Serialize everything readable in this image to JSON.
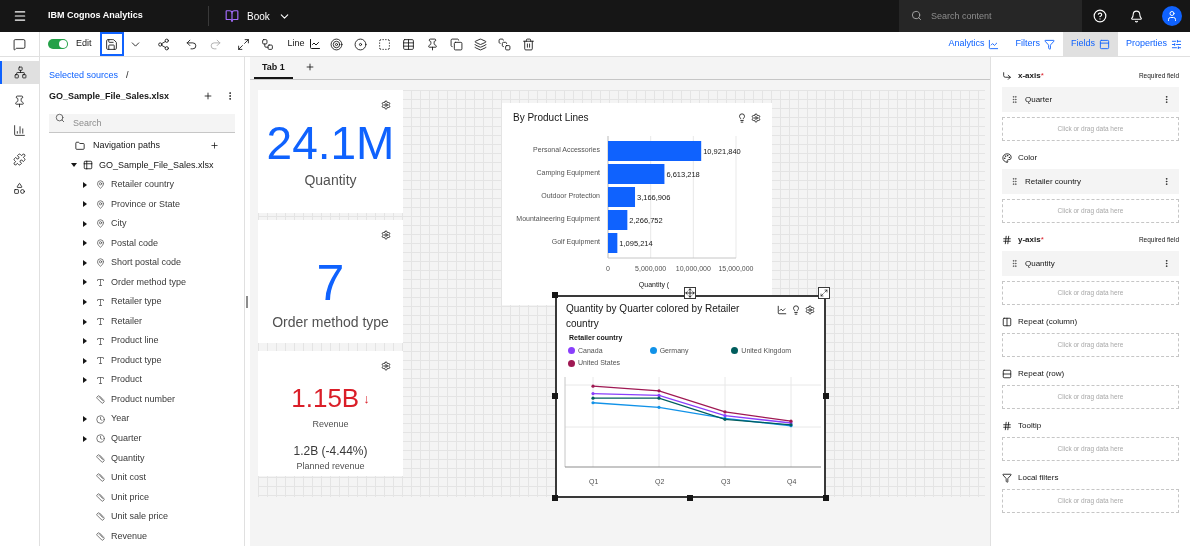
{
  "app_bar": {
    "product": "IBM Cognos Analytics",
    "document": "Book",
    "search": {
      "placeholder": "Search content"
    }
  },
  "toolbar": {
    "edit": {
      "label": "Edit",
      "on": true
    },
    "save_selected": true,
    "visualization": "Line",
    "panels": [
      {
        "label": "Analytics",
        "selected": false
      },
      {
        "label": "Filters",
        "selected": false
      },
      {
        "label": "Fields",
        "selected": true
      },
      {
        "label": "Properties",
        "selected": false
      }
    ]
  },
  "rail": [
    {
      "kind": "sources",
      "selected": true
    },
    {
      "kind": "pin",
      "selected": false
    },
    {
      "kind": "chart",
      "selected": false
    },
    {
      "kind": "puzzle",
      "selected": false
    },
    {
      "kind": "shapes",
      "selected": false
    }
  ],
  "sources": {
    "breadcrumb": "Selected sources",
    "separator": "/",
    "title": "GO_Sample_File_Sales.xlsx",
    "search": {
      "placeholder": "Search"
    },
    "navigation": "Navigation paths",
    "tree": {
      "label": "GO_Sample_File_Sales.xlsx",
      "expanded": true,
      "children": [
        {
          "label": "Retailer country",
          "kind": "location",
          "expandable": true
        },
        {
          "label": "Province or State",
          "kind": "location",
          "expandable": true
        },
        {
          "label": "City",
          "kind": "location",
          "expandable": true
        },
        {
          "label": "Postal code",
          "kind": "location",
          "expandable": true
        },
        {
          "label": "Short postal code",
          "kind": "location",
          "expandable": true
        },
        {
          "label": "Order method type",
          "kind": "text",
          "expandable": true
        },
        {
          "label": "Retailer type",
          "kind": "text",
          "expandable": true
        },
        {
          "label": "Retailer",
          "kind": "text",
          "expandable": true
        },
        {
          "label": "Product line",
          "kind": "text",
          "expandable": true
        },
        {
          "label": "Product type",
          "kind": "text",
          "expandable": true
        },
        {
          "label": "Product",
          "kind": "text",
          "expandable": true
        },
        {
          "label": "Product number",
          "kind": "measure",
          "expandable": false
        },
        {
          "label": "Year",
          "kind": "time",
          "expandable": true
        },
        {
          "label": "Quarter",
          "kind": "time",
          "expandable": true
        },
        {
          "label": "Quantity",
          "kind": "measure",
          "expandable": false
        },
        {
          "label": "Unit cost",
          "kind": "measure",
          "expandable": false
        },
        {
          "label": "Unit price",
          "kind": "measure",
          "expandable": false
        },
        {
          "label": "Unit sale price",
          "kind": "measure",
          "expandable": false
        },
        {
          "label": "Revenue",
          "kind": "measure",
          "expandable": false
        }
      ]
    }
  },
  "tabs": [
    {
      "label": "Tab 1",
      "selected": true
    }
  ],
  "kpis": [
    {
      "value": "24.1M",
      "label": "Quantity"
    },
    {
      "value": "7",
      "label": "Order method type"
    },
    {
      "value": "1.15B",
      "label": "Revenue",
      "arrow": "↓",
      "target": "1.2B (-4.44%)",
      "target_label": "Planned revenue"
    }
  ],
  "bar_card": {
    "title": "By Product Lines",
    "chart_data": {
      "type": "bar",
      "orientation": "horizontal",
      "xlabel": "Quantity (",
      "grid": true,
      "categories": [
        "Personal Accessories",
        "Camping Equipment",
        "Outdoor Protection",
        "Mountaineering Equipment",
        "Golf Equipment"
      ],
      "series": [
        {
          "color": "#0f62fe",
          "values": [
            10921840,
            6613218,
            3166906,
            2266752,
            1095214
          ]
        }
      ],
      "value_labels": [
        "10,921,840",
        "6,613,218",
        "3,166,906",
        "2,266,752",
        "1,095,214"
      ],
      "xlim": [
        0,
        15000000
      ],
      "xticks": [
        {
          "value": 0,
          "label": "0"
        },
        {
          "value": 5000000,
          "label": "5,000,000"
        },
        {
          "value": 10000000,
          "label": "10,000,000"
        },
        {
          "value": 15000000,
          "label": "15,000,000"
        }
      ]
    }
  },
  "line_card": {
    "title": "Quantity by Quarter colored by Retailer country",
    "selected": true,
    "legend_title": "Retailer country",
    "legend": [
      {
        "label": "Canada",
        "color": "#8a3ffc"
      },
      {
        "label": "Germany",
        "color": "#1192e8"
      },
      {
        "label": "United Kingdom",
        "color": "#005d5d"
      },
      {
        "label": "United States",
        "color": "#9f1853"
      }
    ],
    "x_labels": [
      "Q1",
      "Q2",
      "Q3",
      "Q4"
    ]
  },
  "fields": [
    {
      "label": "x-axis",
      "kind": "axis",
      "required_mark": "*",
      "note": "Required field",
      "items": [
        "Quarter"
      ],
      "drop_hint": "Click or drag data here"
    },
    {
      "label": "Color",
      "kind": "color",
      "items": [
        "Retailer country"
      ],
      "drop_hint": "Click or drag data here"
    },
    {
      "label": "y-axis",
      "kind": "hash",
      "required_mark": "*",
      "note": "Required field",
      "items": [
        "Quantity"
      ],
      "drop_hint": "Click or drag data here"
    },
    {
      "label": "Repeat (column)",
      "kind": "column",
      "drop_hint": "Click or drag data here"
    },
    {
      "label": "Repeat (row)",
      "kind": "row",
      "drop_hint": "Click or drag data here"
    },
    {
      "label": "Tooltip",
      "kind": "hash",
      "drop_hint": "Click or drag data here"
    },
    {
      "label": "Local filters",
      "kind": "filter",
      "drop_hint": "Click or drag data here"
    }
  ]
}
